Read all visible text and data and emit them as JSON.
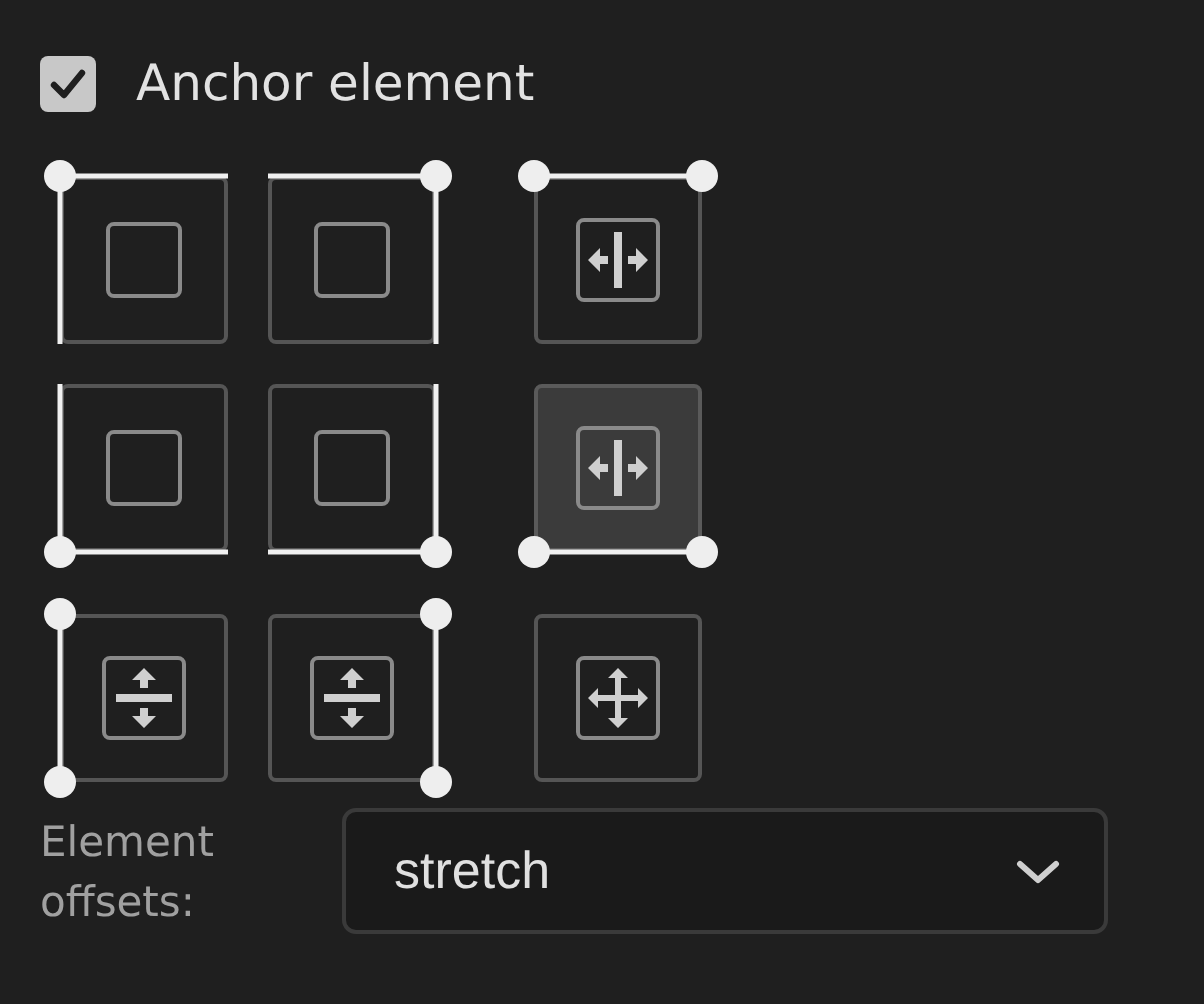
{
  "anchor_element": {
    "label": "Anchor element",
    "checked": true
  },
  "anchors": [
    {
      "kind": "box",
      "top": true,
      "left": true,
      "right": false,
      "bottom": false,
      "selected": false
    },
    {
      "kind": "box",
      "top": true,
      "left": false,
      "right": true,
      "bottom": false,
      "selected": false
    },
    {
      "kind": "horizontal",
      "top": true,
      "left": false,
      "right": false,
      "bottom": false,
      "selected": false
    },
    {
      "kind": "box",
      "top": false,
      "left": true,
      "right": false,
      "bottom": true,
      "selected": false
    },
    {
      "kind": "box",
      "top": false,
      "left": false,
      "right": true,
      "bottom": true,
      "selected": false
    },
    {
      "kind": "horizontal",
      "top": false,
      "left": false,
      "right": false,
      "bottom": true,
      "selected": true
    },
    {
      "kind": "vertical",
      "top": false,
      "left": true,
      "right": false,
      "bottom": false,
      "selected": false
    },
    {
      "kind": "vertical",
      "top": false,
      "left": false,
      "right": true,
      "bottom": false,
      "selected": false
    },
    {
      "kind": "free",
      "top": false,
      "left": false,
      "right": false,
      "bottom": false,
      "selected": false
    }
  ],
  "element_offsets": {
    "label": "Element offsets:",
    "value": "stretch"
  }
}
